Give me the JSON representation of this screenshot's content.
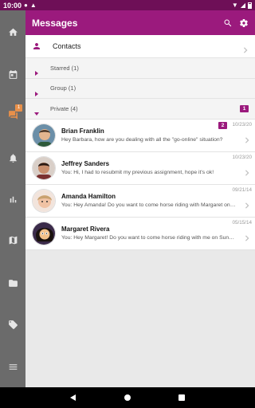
{
  "status_bar": {
    "time": "10:00"
  },
  "rail": {
    "items": [
      {
        "icon": "home-icon"
      },
      {
        "icon": "calendar-icon"
      },
      {
        "icon": "chat-icon",
        "badge": "1",
        "active": true
      },
      {
        "icon": "bell-icon"
      },
      {
        "icon": "bar-chart-icon"
      },
      {
        "icon": "map-icon"
      },
      {
        "icon": "folder-icon"
      },
      {
        "icon": "tag-icon"
      },
      {
        "icon": "menu-icon"
      }
    ]
  },
  "appbar": {
    "title": "Messages"
  },
  "contacts": {
    "label": "Contacts"
  },
  "groups": [
    {
      "label": "Starred (1)",
      "expanded": false
    },
    {
      "label": "Group (1)",
      "expanded": false
    },
    {
      "label": "Private (4)",
      "expanded": true,
      "count": "1"
    }
  ],
  "messages": [
    {
      "name": "Brian Franklin",
      "preview": "Hey Barbara, how are you dealing with all the \"go-online\" situation?",
      "date": "10/23/20",
      "badge": "2"
    },
    {
      "name": "Jeffrey Sanders",
      "preview": "You: Hi, I had to resubmit my previous assignment, hope it's ok!",
      "date": "10/23/20"
    },
    {
      "name": "Amanda Hamilton",
      "preview": "You: Hey Amanda! Do you want to come horse riding with Margaret on Sunday?",
      "date": "09/21/14"
    },
    {
      "name": "Margaret Rivera",
      "preview": "You: Hey Margaret! Do you want to come horse riding with me on Sunday?",
      "date": "05/15/14"
    }
  ],
  "colors": {
    "brand": "#9b1a7d",
    "status": "#6e0f57",
    "rail": "#6b6b6b",
    "accent": "#e8904a"
  }
}
